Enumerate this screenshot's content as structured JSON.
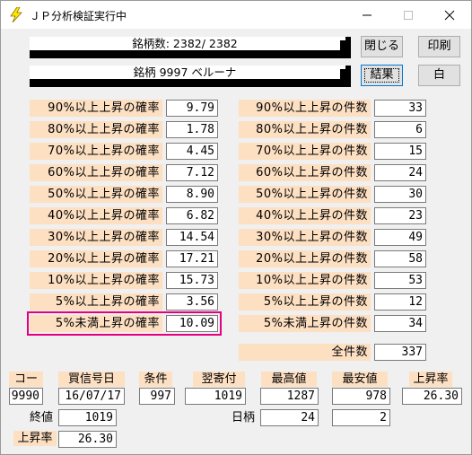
{
  "window": {
    "title": "ＪＰ分析検証実行中"
  },
  "bars": {
    "count_text": "銘柄数: 2382/ 2382",
    "stock_text": "銘柄 9997 ベルーナ"
  },
  "buttons": {
    "close": "閉じる",
    "print": "印刷",
    "result": "結果",
    "white": "白"
  },
  "probabilities": [
    {
      "label": "90%以上上昇の確率",
      "value": "9.79"
    },
    {
      "label": "80%以上上昇の確率",
      "value": "1.78"
    },
    {
      "label": "70%以上上昇の確率",
      "value": "4.45"
    },
    {
      "label": "60%以上上昇の確率",
      "value": "7.12"
    },
    {
      "label": "50%以上上昇の確率",
      "value": "8.90"
    },
    {
      "label": "40%以上上昇の確率",
      "value": "6.82"
    },
    {
      "label": "30%以上上昇の確率",
      "value": "14.54"
    },
    {
      "label": "20%以上上昇の確率",
      "value": "17.21"
    },
    {
      "label": "10%以上上昇の確率",
      "value": "15.73"
    },
    {
      "label": "5%以上上昇の確率",
      "value": "3.56"
    },
    {
      "label": "5%未満上昇の確率",
      "value": "10.09"
    }
  ],
  "counts": [
    {
      "label": "90%以上上昇の件数",
      "value": "33"
    },
    {
      "label": "80%以上上昇の件数",
      "value": "6"
    },
    {
      "label": "70%以上上昇の件数",
      "value": "15"
    },
    {
      "label": "60%以上上昇の件数",
      "value": "24"
    },
    {
      "label": "50%以上上昇の件数",
      "value": "30"
    },
    {
      "label": "40%以上上昇の件数",
      "value": "23"
    },
    {
      "label": "30%以上上昇の件数",
      "value": "49"
    },
    {
      "label": "20%以上上昇の件数",
      "value": "58"
    },
    {
      "label": "10%以上上昇の件数",
      "value": "53"
    },
    {
      "label": "5%以上上昇の件数",
      "value": "12"
    },
    {
      "label": "5%未満上昇の件数",
      "value": "34"
    }
  ],
  "total": {
    "label": "全件数",
    "value": "337"
  },
  "bottom": {
    "code": {
      "label": "コード",
      "value": "9990"
    },
    "buy_date": {
      "label": "買信号日",
      "value": "16/07/17"
    },
    "condition": {
      "label": "条件",
      "value": "997"
    },
    "next_open": {
      "label": "翌寄付",
      "value": "1019"
    },
    "high": {
      "label": "最高値",
      "value": "1287"
    },
    "low": {
      "label": "最安値",
      "value": "978"
    },
    "rise_rate": {
      "label": "上昇率",
      "value": "26.30"
    },
    "close_price": {
      "label": "終値",
      "value": "1019"
    },
    "days": {
      "label": "日柄",
      "value": "24"
    },
    "extra": {
      "value": "2"
    },
    "rise_rate2": {
      "label": "上昇率",
      "value": "26.30"
    }
  }
}
